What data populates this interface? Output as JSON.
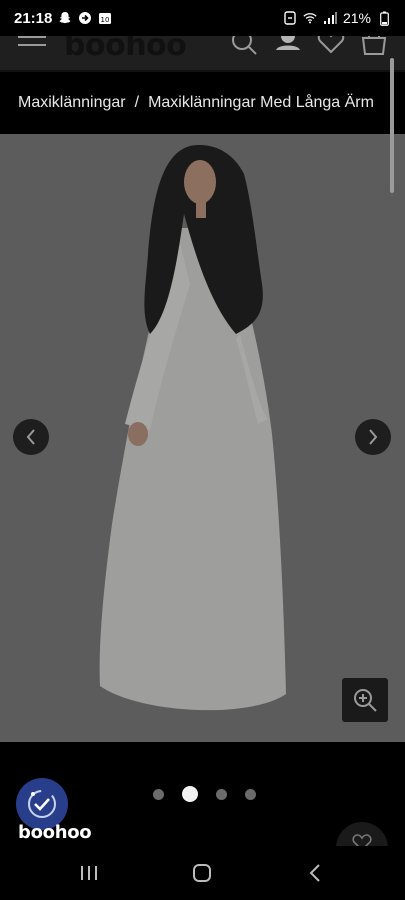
{
  "status_bar": {
    "time": "21:18",
    "battery": "21%",
    "left_icons": [
      "snapchat-icon",
      "arrow-circle-icon",
      "calendar-icon"
    ],
    "right_icons": [
      "alarm-icon",
      "wifi-icon",
      "signal-icon"
    ]
  },
  "header": {
    "logo": "boohoo",
    "icons": [
      "menu-icon",
      "search-icon",
      "account-icon",
      "heart-icon",
      "bag-icon"
    ]
  },
  "breadcrumb": {
    "items": [
      "Maxiklänningar",
      "Maxiklänningar Med Långa Ärm"
    ],
    "separator": "/"
  },
  "gallery": {
    "current_index": 1,
    "total": 4,
    "icons": [
      "chevron-left-icon",
      "chevron-right-icon",
      "zoom-in-icon"
    ]
  },
  "trust_badge": {
    "label": "boohoo"
  },
  "colors": {
    "page_background": "#000000",
    "image_background": "#5c5c5c",
    "badge_blue": "#283e8a",
    "dress_overlay": "#9e9f9c"
  },
  "nav_icons": [
    "recent-apps-icon",
    "home-icon",
    "back-icon"
  ]
}
